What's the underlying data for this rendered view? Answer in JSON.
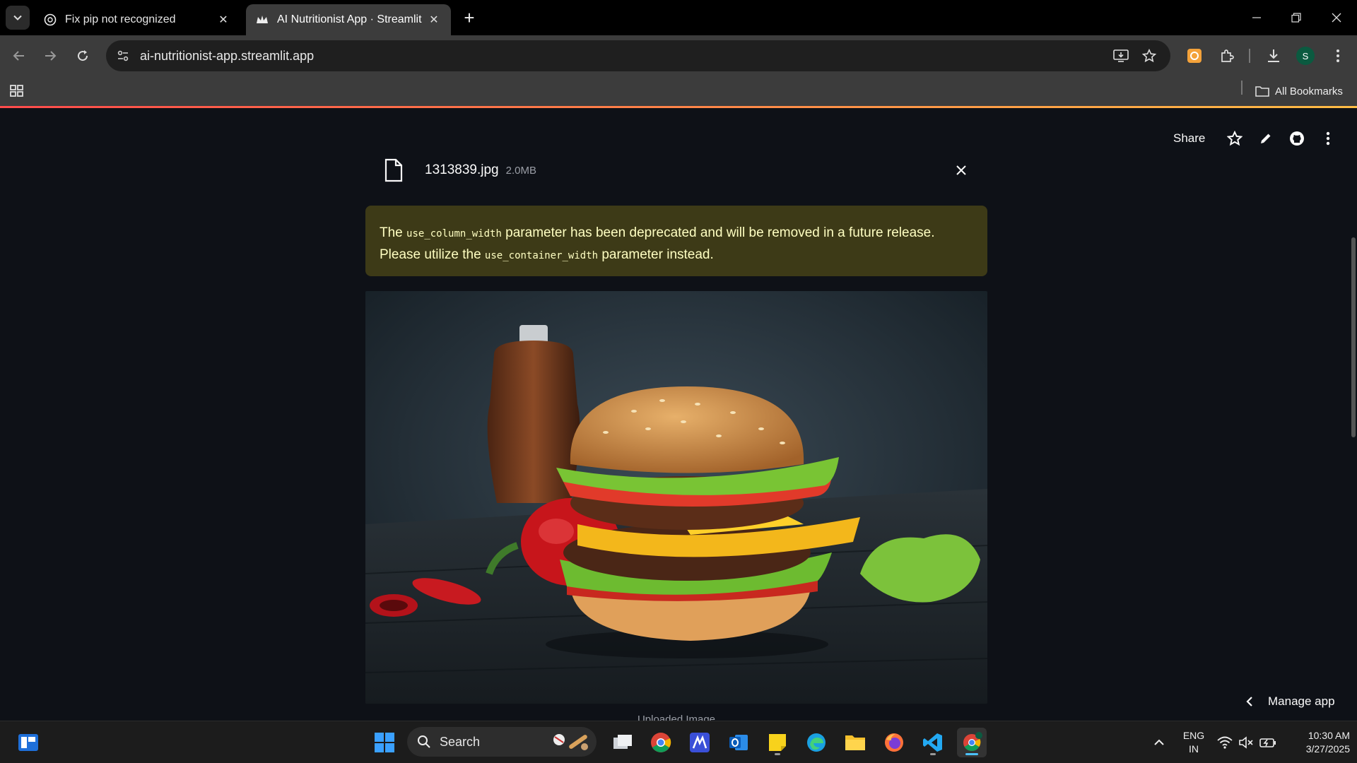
{
  "browser": {
    "tabs": [
      {
        "title": "Fix pip not recognized",
        "active": false
      },
      {
        "title": "AI Nutritionist App · Streamlit",
        "active": true
      }
    ],
    "url": "ai-nutritionist-app.streamlit.app",
    "bookmarks_label": "All Bookmarks",
    "profile_initial": "S"
  },
  "app": {
    "header": {
      "share_label": "Share"
    },
    "uploaded_file": {
      "name": "1313839.jpg",
      "size": "2.0MB"
    },
    "warning": {
      "part1": "The ",
      "code1": "use_column_width",
      "part2": " parameter has been deprecated and will be removed in a future release. Please utilize the ",
      "code2": "use_container_width",
      "part3": " parameter instead."
    },
    "image_caption": "Uploaded Image",
    "manage_app_label": "Manage app"
  },
  "taskbar": {
    "search_placeholder": "Search",
    "language": {
      "line1": "ENG",
      "line2": "IN"
    },
    "clock": {
      "time": "10:30 AM",
      "date": "3/27/2025"
    }
  },
  "colors": {
    "app_background": "#0e1117",
    "warning_background": "#3d3a17",
    "warning_text": "#ffffc2",
    "accent_gradient_start": "#ff4b4b",
    "accent_gradient_end": "#ffbd45"
  }
}
